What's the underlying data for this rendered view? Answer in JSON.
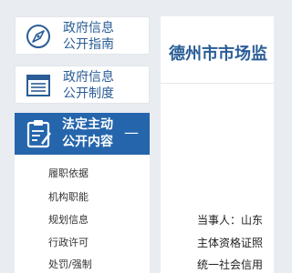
{
  "sidebar": {
    "items": [
      {
        "line1": "政府信息",
        "line2": "公开指南",
        "icon": "compass-icon"
      },
      {
        "line1": "政府信息",
        "line2": "公开制度",
        "icon": "list-document-icon"
      }
    ],
    "active": {
      "line1": "法定主动",
      "line2": "公开内容",
      "icon": "clipboard-edit-icon",
      "toggle": "—"
    },
    "submenu": [
      "履职依据",
      "机构职能",
      "规划信息",
      "行政许可",
      "处罚/强制"
    ]
  },
  "main": {
    "title": "德州市市场监",
    "lines": [
      "当事人：山东",
      "主体资格证照",
      "统一社会信用"
    ]
  },
  "colors": {
    "accent": "#2565ac",
    "title": "#2a5d96",
    "background": "#e9edf1"
  }
}
